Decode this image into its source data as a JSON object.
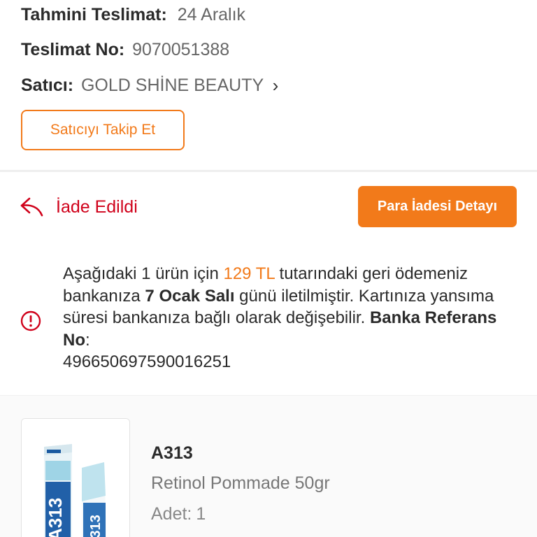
{
  "order": {
    "estimated_delivery_label": "Tahmini Teslimat:",
    "estimated_delivery_value": "24 Aralık",
    "delivery_no_label": "Teslimat No:",
    "delivery_no_value": "9070051388",
    "seller_label": "Satıcı:",
    "seller_value": "GOLD SHİNE BEAUTY",
    "follow_seller_button": "Satıcıyı Takip Et"
  },
  "return": {
    "status_label": "İade Edildi",
    "refund_detail_button": "Para İadesi Detayı"
  },
  "notice": {
    "part1": "Aşağıdaki 1 ürün için ",
    "amount": "129 TL",
    "part2": " tutarındaki geri ödemeniz bankanıza ",
    "date": "7 Ocak Salı",
    "part3": " günü iletilmiştir. Kartınıza yansıma süresi bankanıza bağlı olarak değişebilir. ",
    "ref_label": "Banka Referans No",
    "part4": ": ",
    "ref_value": "496650697590016251"
  },
  "product": {
    "brand": "A313",
    "name": "Retinol Pommade 50gr",
    "qty_label": "Adet:",
    "qty_value": "1",
    "package_text": "A313"
  },
  "colors": {
    "accent": "#f27a1a",
    "return_red": "#d0021b"
  },
  "icons": {
    "seller_chevron": "chevron-right-icon",
    "return": "return-arrow-icon",
    "info": "info-circle-icon"
  }
}
